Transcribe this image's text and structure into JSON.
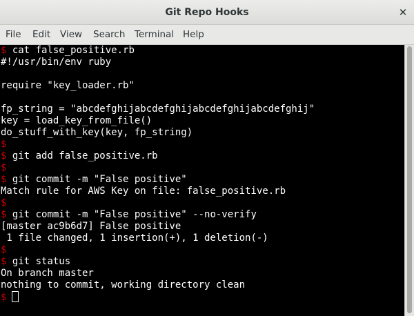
{
  "window": {
    "title": "Git Repo Hooks",
    "close_icon": "✕"
  },
  "menu": [
    "File",
    "Edit",
    "View",
    "Search",
    "Terminal",
    "Help"
  ],
  "terminal": {
    "prompt_symbol": "$",
    "lines": [
      {
        "prompt": true,
        "text": " cat false_positive.rb"
      },
      {
        "prompt": false,
        "text": "#!/usr/bin/env ruby"
      },
      {
        "prompt": false,
        "text": ""
      },
      {
        "prompt": false,
        "text": "require \"key_loader.rb\""
      },
      {
        "prompt": false,
        "text": ""
      },
      {
        "prompt": false,
        "text": "fp_string = \"abcdefghijabcdefghijabcdefghijabcdefghij\""
      },
      {
        "prompt": false,
        "text": "key = load_key_from_file()"
      },
      {
        "prompt": false,
        "text": "do_stuff_with_key(key, fp_string)"
      },
      {
        "prompt": true,
        "text": ""
      },
      {
        "prompt": true,
        "text": " git add false_positive.rb"
      },
      {
        "prompt": true,
        "text": ""
      },
      {
        "prompt": true,
        "text": " git commit -m \"False positive\""
      },
      {
        "prompt": false,
        "text": "Match rule for AWS Key on file: false_positive.rb"
      },
      {
        "prompt": true,
        "text": ""
      },
      {
        "prompt": true,
        "text": " git commit -m \"False positive\" --no-verify"
      },
      {
        "prompt": false,
        "text": "[master ac9b6d7] False positive"
      },
      {
        "prompt": false,
        "text": " 1 file changed, 1 insertion(+), 1 deletion(-)"
      },
      {
        "prompt": true,
        "text": ""
      },
      {
        "prompt": true,
        "text": " git status"
      },
      {
        "prompt": false,
        "text": "On branch master"
      },
      {
        "prompt": false,
        "text": "nothing to commit, working directory clean"
      },
      {
        "prompt": true,
        "text": "",
        "cursor": true
      }
    ]
  },
  "colors": {
    "prompt": "#cc0000",
    "terminal_bg": "#000000",
    "terminal_fg": "#ffffff"
  }
}
